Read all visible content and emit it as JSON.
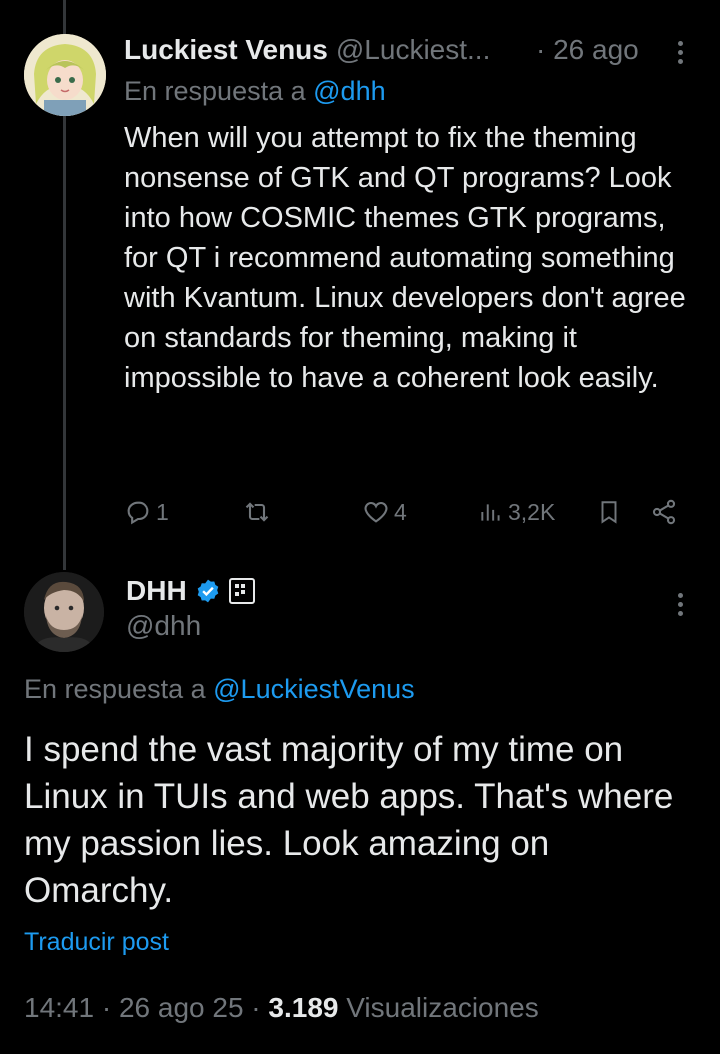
{
  "reply": {
    "name": "Luckiest Venus",
    "handle": "@Luckiest...",
    "time": "· 26 ago",
    "in_reply_prefix": "En respuesta a",
    "in_reply_handle": "@dhh",
    "text": "When will you attempt to fix the theming nonsense of GTK and QT programs? Look into how COSMIC themes GTK programs, for QT i recommend automating something with Kvantum. Linux developers don't agree on standards for theming, making it impossible to have a coherent look easily.",
    "actions": {
      "replies": "1",
      "reposts": "",
      "likes": "4",
      "views": "3,2K"
    }
  },
  "main": {
    "name": "DHH",
    "handle": "@dhh",
    "in_reply_prefix": "En respuesta a",
    "in_reply_handle": "@LuckiestVenus",
    "text": "I spend the vast majority of my time on Linux in TUIs and web apps. That's where my passion lies. Look amazing on Omarchy.",
    "translate": "Traducir post",
    "timestamp": "14:41 · 26 ago 25 ·",
    "views_count": "3.189",
    "views_label": "Visualizaciones"
  },
  "colors": {
    "background": "#000000",
    "text": "#e7e9ea",
    "muted": "#71767b",
    "link": "#1d9bf0"
  },
  "icons": [
    "more-icon",
    "reply-icon",
    "repost-icon",
    "like-icon",
    "views-icon",
    "bookmark-icon",
    "share-icon",
    "verified-badge-icon",
    "affiliate-badge-icon"
  ]
}
